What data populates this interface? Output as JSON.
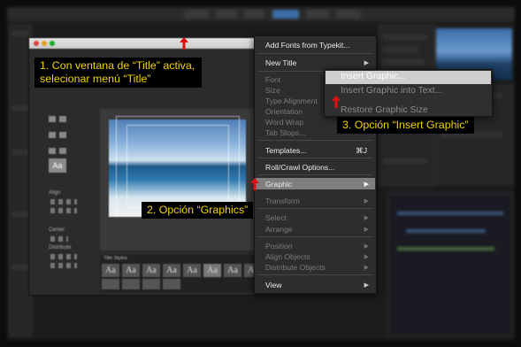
{
  "menu": {
    "items": [
      {
        "label": "Add Fonts from Typekit...",
        "disabled": false
      },
      {
        "label": "New Title",
        "disabled": false,
        "submenu": true
      },
      {
        "label": "Font",
        "disabled": true,
        "submenu": true
      },
      {
        "label": "Size",
        "disabled": true
      },
      {
        "label": "Type Alignment",
        "disabled": true
      },
      {
        "label": "Orientation",
        "disabled": true
      },
      {
        "label": "Word Wrap",
        "disabled": true
      },
      {
        "label": "Tab Stops...",
        "disabled": true
      },
      {
        "label": "Templates...",
        "disabled": false,
        "shortcut": "⌘J"
      },
      {
        "label": "Roll/Crawl Options...",
        "disabled": false
      },
      {
        "label": "Graphic",
        "disabled": false,
        "submenu": true,
        "highlighted": true
      },
      {
        "label": "Transform",
        "disabled": true,
        "submenu": true
      },
      {
        "label": "Select",
        "disabled": true,
        "submenu": true
      },
      {
        "label": "Arrange",
        "disabled": true,
        "submenu": true
      },
      {
        "label": "Position",
        "disabled": true,
        "submenu": true
      },
      {
        "label": "Align Objects",
        "disabled": true,
        "submenu": true
      },
      {
        "label": "Distribute Objects",
        "disabled": true,
        "submenu": true
      },
      {
        "label": "View",
        "disabled": false,
        "submenu": true
      }
    ]
  },
  "graphic_submenu": {
    "items": [
      {
        "label": "Insert Graphic...",
        "highlighted": true
      },
      {
        "label": "Insert Graphic into Text..."
      },
      {
        "label": "Restore Graphic Size"
      }
    ]
  },
  "callouts": {
    "step1": "1. Con ventana de “Title” activa, selecionar menú “Title”",
    "step2": "2. Opción “Graphics”",
    "step3": "3. Opción “Insert Graphic”"
  },
  "title_window": {
    "title_styles_label": "Title Styles",
    "align_label": "Align",
    "center_label": "Center",
    "distribute_label": "Distribute",
    "swatch_label": "Aa"
  },
  "colors": {
    "callout_text": "#f3d400",
    "arrow": "#e01010",
    "menu_bg": "#2d2d2d",
    "highlight": "#7f7f7f"
  }
}
